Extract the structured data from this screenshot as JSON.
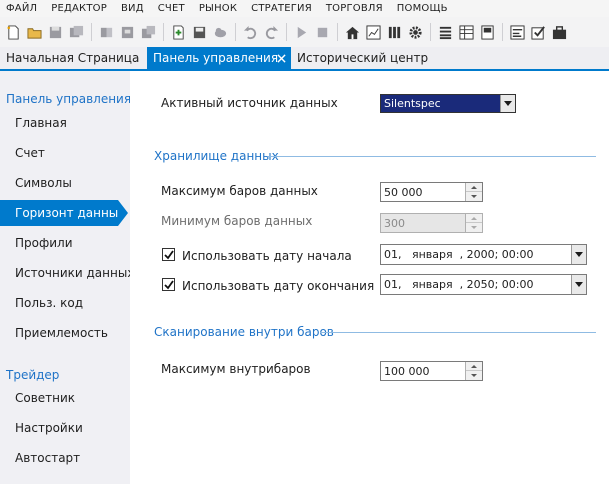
{
  "menu": [
    "ФАЙЛ",
    "РЕДАКТОР",
    "ВИД",
    "СЧЕТ",
    "РЫНОК",
    "СТРАТЕГИЯ",
    "ТОРГОВЛЯ",
    "ПОМОЩЬ"
  ],
  "toolbar_icons": [
    "new-file-icon",
    "open-folder-icon",
    "save-icon",
    "save-all-icon",
    "cut-icon",
    "copy-icon",
    "paste-icon",
    "add-icon",
    "disk-icon",
    "cloud-icon",
    "undo-icon",
    "redo-icon",
    "play-icon",
    "stop-icon",
    "home-icon",
    "chart-icon",
    "bars-icon",
    "gear-icon",
    "list-icon",
    "grid-icon",
    "document-icon",
    "sliders-icon",
    "checklist-icon",
    "briefcase-icon"
  ],
  "tabs": {
    "home": "Начальная Страница",
    "control_panel": "Панель управления",
    "history": "Исторический центр"
  },
  "sidebar": {
    "header1": "Панель управления",
    "items1": [
      "Главная",
      "Счет",
      "Символы",
      "Горизонт данных",
      "Профили",
      "Источники данных",
      "Польз. код",
      "Приемлемость"
    ],
    "header2": "Трейдер",
    "items2": [
      "Советник",
      "Настройки",
      "Автостарт"
    ]
  },
  "form": {
    "active_source_label": "Активный источник данных",
    "active_source_value": "Silentspec",
    "storage_section": "Хранилище данных",
    "max_bars_label": "Максимум баров данных",
    "max_bars_value": "50 000",
    "min_bars_label": "Минимум баров данных",
    "min_bars_value": "300",
    "use_start_label": "Использовать дату начала",
    "start_date_value": "01,   января  , 2000; 00:00",
    "use_end_label": "Использовать дату окончания",
    "end_date_value": "01,   января  , 2050; 00:00",
    "intrabar_section": "Сканирование внутри баров",
    "max_intrabars_label": "Максимум внутрибаров",
    "max_intrabars_value": "100 000"
  },
  "colors": {
    "accent": "#007acc",
    "section_text": "#1f73c7",
    "selected_dropdown": "#1a2a7a"
  }
}
